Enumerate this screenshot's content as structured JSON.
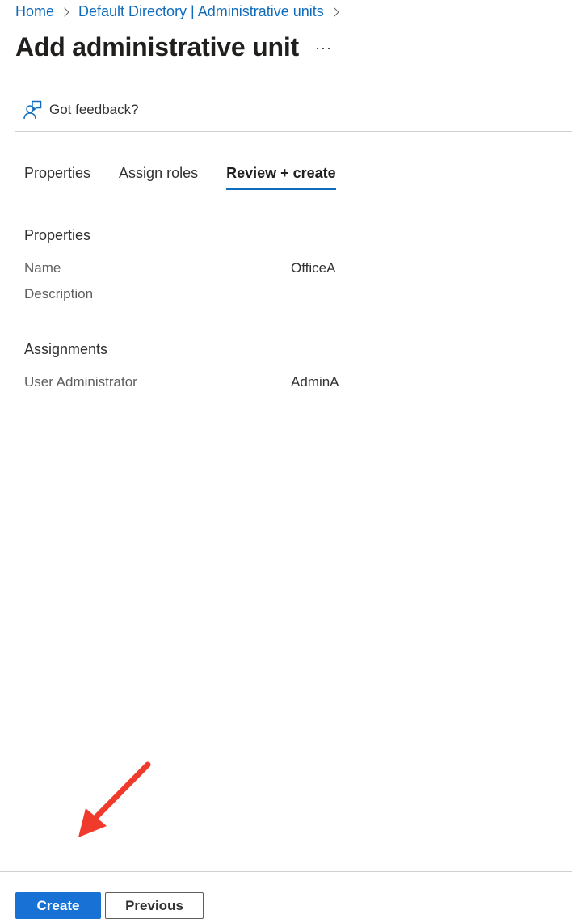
{
  "breadcrumb": {
    "items": [
      "Home",
      "Default Directory | Administrative units"
    ]
  },
  "header": {
    "title": "Add administrative unit",
    "more_label": "···"
  },
  "feedback": {
    "label": "Got feedback?",
    "icon": "feedback-person-icon"
  },
  "tabs": [
    {
      "label": "Properties",
      "active": false
    },
    {
      "label": "Assign roles",
      "active": false
    },
    {
      "label": "Review + create",
      "active": true
    }
  ],
  "review": {
    "properties": {
      "title": "Properties",
      "rows": [
        {
          "label": "Name",
          "value": "OfficeA"
        },
        {
          "label": "Description",
          "value": ""
        }
      ]
    },
    "assignments": {
      "title": "Assignments",
      "rows": [
        {
          "label": "User Administrator",
          "value": "AdminA"
        }
      ]
    }
  },
  "footer": {
    "create_label": "Create",
    "previous_label": "Previous"
  },
  "colors": {
    "accent": "#0f6cbd",
    "primary_button": "#1872d6",
    "annotation_arrow": "#f03a2c"
  }
}
